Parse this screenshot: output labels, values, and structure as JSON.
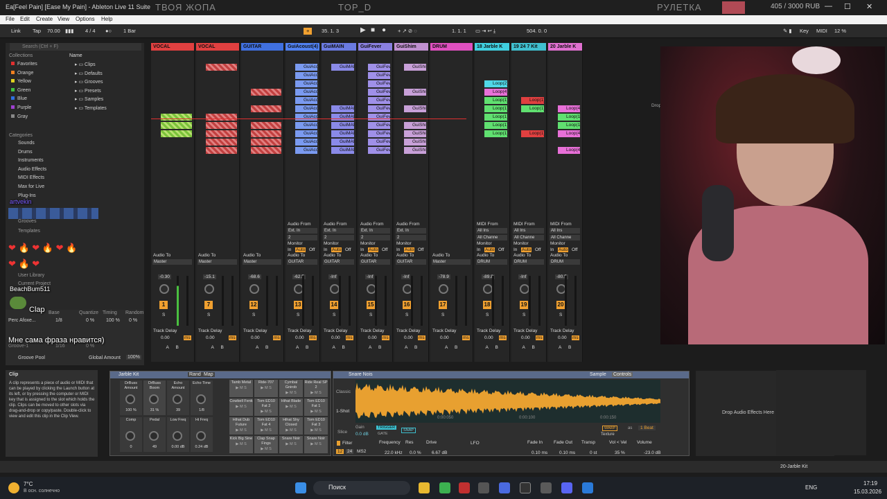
{
  "window": {
    "app_title": "Ea[Feel Pain] [Ease My Pain] - Ableton Live 11 Suite",
    "overlay_center": "ТВОЯ ЖОПА",
    "overlay_top": "TOP_D",
    "overlay_roulette": "РУЛЕТКА",
    "goal_text": "405 / 3000 RUB",
    "minimize_label": "—",
    "maximize_label": "☐",
    "close_label": "✕"
  },
  "menu": [
    "File",
    "Edit",
    "Create",
    "View",
    "Options",
    "Help"
  ],
  "control_bar": {
    "link": "Link",
    "tap": "Tap",
    "tempo": "70.00",
    "signature": "4 / 4",
    "quantize": "1 Bar",
    "position": "35. 1. 3",
    "loop_start": "1. 1. 1",
    "loop_length": "504. 0. 0",
    "key_label": "Key",
    "midi_label": "MIDI",
    "cpu": "12 %"
  },
  "browser": {
    "search_placeholder": "Search (Ctrl + F)",
    "collections_title": "Collections",
    "name_col": "Name",
    "collections": [
      {
        "label": "Favorites",
        "color": "#e03030"
      },
      {
        "label": "Orange",
        "color": "#f08020"
      },
      {
        "label": "Yellow",
        "color": "#e0d020"
      },
      {
        "label": "Green",
        "color": "#40c040"
      },
      {
        "label": "Blue",
        "color": "#3070e0"
      },
      {
        "label": "Purple",
        "color": "#a040d0"
      },
      {
        "label": "Gray",
        "color": "#888888"
      }
    ],
    "categories_title": "Categories",
    "categories": [
      "Sounds",
      "Drums",
      "Instruments",
      "Audio Effects",
      "MIDI Effects",
      "Max for Live",
      "Plug-Ins"
    ],
    "places": [
      "Grooves",
      "Templates",
      "User Library",
      "Current Project"
    ],
    "folders": [
      "Clips",
      "Defaults",
      "Grooves",
      "Presets",
      "Samples",
      "Templates"
    ],
    "groove_header": [
      "Groove Name",
      "Base",
      "Quantize",
      "Timing",
      "Random"
    ],
    "groove_row": [
      "Perc Afoxe...",
      "1/8",
      "0 %",
      "100 %",
      "0 %"
    ],
    "groove_row2": [
      "Groove-1",
      "1/16",
      "0 %"
    ],
    "groove_pool": "Groove Pool",
    "global_amount_label": "Global Amount",
    "global_amount": "100%"
  },
  "chat": [
    {
      "user": "artvekin",
      "text": ""
    },
    {
      "user": "BeachBum511",
      "text": "Clap"
    },
    {
      "user": "",
      "text": "Мне сама фраза нравится)"
    }
  ],
  "tracks": [
    {
      "name": "VOCAL",
      "color": "#e04040",
      "routing_to": "Master",
      "vol": "-0.30",
      "num": "1",
      "delay": "0.00"
    },
    {
      "name": "VOCAL",
      "color": "#e04040",
      "routing_to": "Master",
      "vol": "-15.1",
      "num": "7",
      "delay": "0.00"
    },
    {
      "name": "GUITAR",
      "color": "#4070e0",
      "routing_to": "Master",
      "vol": "-68.6",
      "num": "12",
      "delay": "0.00"
    },
    {
      "name": "GuiAcoust(4)",
      "color": "#5080f0",
      "from": "Audio From",
      "in": "Ext. In",
      "ch": "2",
      "routing_to": "GUITAR",
      "vol": "-62.5",
      "num": "13",
      "delay": "0.00"
    },
    {
      "name": "GuiMAIN",
      "color": "#6a7ae0",
      "from": "Audio From",
      "in": "Ext. In",
      "ch": "2",
      "routing_to": "GUITAR",
      "vol": "-Inf",
      "num": "14",
      "delay": "0.00"
    },
    {
      "name": "GuiFever",
      "color": "#8a80e0",
      "from": "Audio From",
      "in": "Ext. In",
      "ch": "2",
      "routing_to": "GUITAR",
      "vol": "-Inf",
      "num": "15",
      "delay": "0.00"
    },
    {
      "name": "GuiShim",
      "color": "#c090d0",
      "from": "Audio From",
      "in": "Ext. In",
      "ch": "2",
      "routing_to": "GUITAR",
      "vol": "-Inf",
      "num": "16",
      "delay": "0.00"
    },
    {
      "name": "DRUM",
      "color": "#e050c0",
      "routing_to": "Master",
      "vol": "-78.9",
      "num": "17",
      "delay": "0.00"
    },
    {
      "name": "18 Jarble K",
      "color": "#40d0e0",
      "from": "MIDI From",
      "in": "All Ins",
      "ch": "All Channe",
      "routing_to": "DRUM",
      "vol": "-89.8",
      "num": "18",
      "delay": "0.00"
    },
    {
      "name": "19 24 7 Kit",
      "color": "#40c0d0",
      "from": "MIDI From",
      "in": "All Ins",
      "ch": "All Channe",
      "routing_to": "DRUM",
      "vol": "-Inf",
      "num": "19",
      "delay": "0.00"
    },
    {
      "name": "20 Jarble K",
      "color": "#e070d0",
      "from": "MIDI From",
      "in": "All Ins",
      "ch": "All Channe",
      "routing_to": "DRUM",
      "vol": "-80.5",
      "num": "20",
      "delay": "0.00"
    }
  ],
  "clip_names": {
    "guiacoust": "GuiAcoust",
    "guimain": "GuiMAIN",
    "guifever": "GuiFever",
    "guishim": "GuiShim",
    "loop2": "Loop(2)",
    "loop4": "Loop(4)",
    "loop1": "Loop(1)"
  },
  "labels": {
    "monitor": "Monitor",
    "in": "In",
    "auto": "Auto",
    "off": "Off",
    "audio_to": "Audio To",
    "track_delay": "Track Delay",
    "ms": "ms",
    "a": "A",
    "b": "B",
    "s": "S",
    "drop": "Drop"
  },
  "info_view": {
    "title": "Clip",
    "body": "A clip represents a piece of audio or MIDI that can be played by clicking the Launch button at its left, or by pressing the computer or MIDI key that is assigned to the slot which holds the clip. Clips can be moved to other slots via drag-and-drop or copy/paste. Double-click to view and edit this clip in the Clip View."
  },
  "drum_rack": {
    "title": "Jarble Kit",
    "rand": "Rand",
    "map": "Map",
    "macros": [
      {
        "label": "DrBuss Amount",
        "value": "100 %"
      },
      {
        "label": "DrBuss Boom",
        "value": "31 %"
      },
      {
        "label": "Echo Amount",
        "value": "39"
      },
      {
        "label": "Echo Time",
        "value": "1/8"
      },
      {
        "label": "Comp",
        "value": "0"
      },
      {
        "label": "Pedal",
        "value": "49"
      },
      {
        "label": "Low Freq",
        "value": "0.00 dB"
      },
      {
        "label": "Hi Freq",
        "value": "0.24 dB"
      }
    ],
    "pads": [
      "Tamb Metal",
      "Ride-707",
      "Cymbal Gnirob",
      "Ride Real SP 2",
      "Cowbell Fenk",
      "Tom ED10 Fat 2",
      "Hihat Blade",
      "Tom ED10 Fat 1",
      "Hihat Dub Future",
      "Tom ED10 Fat 4",
      "Hihat Shy Closed",
      "Tom ED10 Fat 3",
      "Kick Big Sine",
      "Clap Snap Fings",
      "Snare Noir",
      "Snare Noir"
    ]
  },
  "sampler": {
    "title": "Snare Nois",
    "sample_tab": "Sample",
    "controls_tab": "Controls",
    "mode_classic": "Classic",
    "mode_1shot": "1-Shot",
    "mode_slice": "Slice",
    "time1": "0:00:050",
    "time2": "0:00:100",
    "time3": "0:00:150",
    "gain_label": "Gain",
    "gain": "0.0 dB",
    "trigger": "TRIGGER",
    "gate": "GATE",
    "snap": "SNAP",
    "warp": "WARP",
    "as_label": "as",
    "beat": "1 Beat",
    "texture": "Texture",
    "filter": "Filter",
    "frequency_label": "Frequency",
    "frequency": "22.0 kHz",
    "res_label": "Res",
    "res": "0.0 %",
    "drive_label": "Drive",
    "drive": "6.67 dB",
    "lfo": "LFO",
    "fade_in_label": "Fade In",
    "fade_in": "0.10 ms",
    "fade_out_label": "Fade Out",
    "fade_out": "0.10 ms",
    "transp_label": "Transp",
    "transp": "0 st",
    "vol_vel_label": "Vol < Vel",
    "vol_vel": "35 %",
    "volume_label": "Volume",
    "volume": "-23.0 dB",
    "filter_mode": "MS2",
    "filter_val": "12",
    "filter_val2": "24"
  },
  "drop_zone": "Drop Audio Effects Here",
  "status_bar": {
    "right": "20-Jarble Kit"
  },
  "taskbar": {
    "weather_temp": "7°C",
    "weather_desc": "В осн. солнечно",
    "search": "Поиск",
    "lang": "ENG",
    "time": "17:19",
    "date": "15.03.2026"
  }
}
